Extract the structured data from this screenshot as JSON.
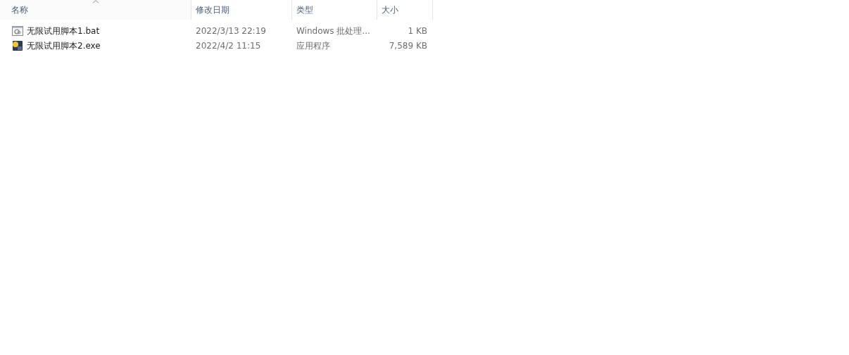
{
  "columns": [
    {
      "label": "名称",
      "sorted": true
    },
    {
      "label": "修改日期",
      "sorted": false
    },
    {
      "label": "类型",
      "sorted": false
    },
    {
      "label": "大小",
      "sorted": false
    }
  ],
  "rows": [
    {
      "kind": "batch",
      "name": "无限试用脚本1.bat",
      "modified": "2022/3/13 22:19",
      "type": "Windows 批处理...",
      "size": "1 KB"
    },
    {
      "kind": "application",
      "name": "无限试用脚本2.exe",
      "modified": "2022/4/2 11:15",
      "type": "应用程序",
      "size": "7,589 KB"
    }
  ]
}
